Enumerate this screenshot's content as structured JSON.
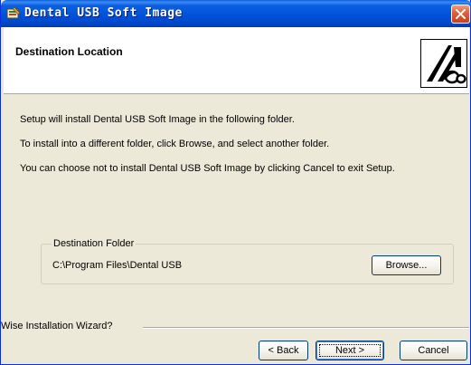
{
  "window": {
    "title": "Dental USB Soft Image"
  },
  "header": {
    "title": "Destination Location"
  },
  "body": {
    "line1": "Setup will install Dental USB Soft Image in the following folder.",
    "line2": "To install into a different folder, click Browse, and select another folder.",
    "line3": "You can choose not to install Dental USB Soft Image by clicking Cancel to exit Setup."
  },
  "destination": {
    "group_label": "Destination Folder",
    "path": "C:\\Program Files\\Dental USB",
    "browse_label": "Browse..."
  },
  "footer": {
    "wizard_label": "Wise Installation Wizard?",
    "back_label": "< Back",
    "next_label": "Next >",
    "cancel_label": "Cancel"
  },
  "icons": {
    "title_icon": "installer-icon",
    "close_icon": "close-icon",
    "logo": "dental-logo-icon"
  },
  "colors": {
    "titlebar": "#0050d8",
    "close": "#e0603a",
    "dialog": "#ece9d8"
  }
}
